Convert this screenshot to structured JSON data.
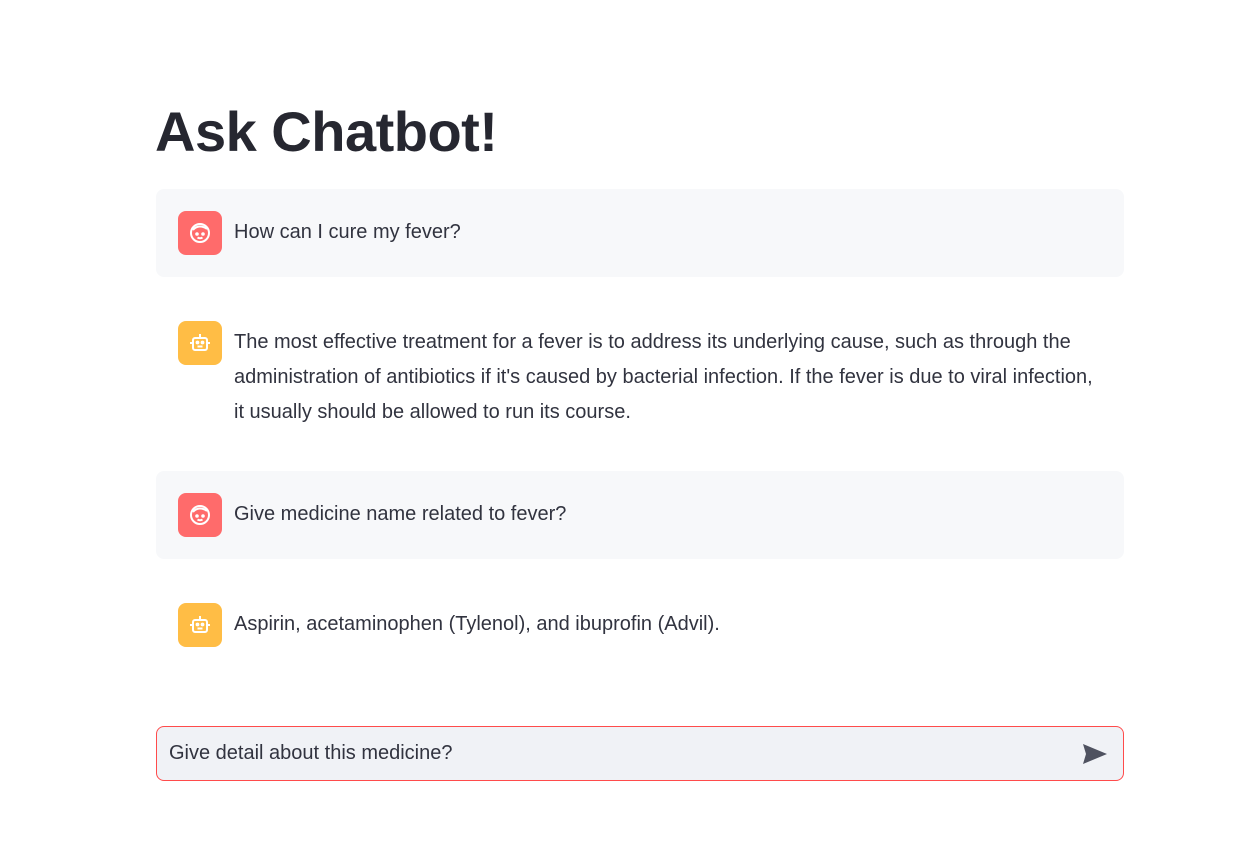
{
  "header": {
    "title": "Ask Chatbot!"
  },
  "messages": [
    {
      "role": "user",
      "avatar_icon": "user-face-icon",
      "text": "How can I cure my fever?"
    },
    {
      "role": "assistant",
      "avatar_icon": "robot-icon",
      "text": "The most effective treatment for a fever is to address its underlying cause, such as through the administration of antibiotics if it's caused by bacterial infection. If the fever is due to viral infection, it usually should be allowed to run its course."
    },
    {
      "role": "user",
      "avatar_icon": "user-face-icon",
      "text": "Give medicine name related to fever?"
    },
    {
      "role": "assistant",
      "avatar_icon": "robot-icon",
      "text": "Aspirin, acetaminophen (Tylenol), and ibuprofin (Advil)."
    }
  ],
  "chat_input": {
    "value": "Give detail about this medicine?",
    "send_icon": "send-icon"
  },
  "colors": {
    "user_avatar": "#ff6b6b",
    "assistant_avatar": "#ffbd45",
    "input_border": "#ff4b4b",
    "user_bubble": "#f7f8fa"
  }
}
